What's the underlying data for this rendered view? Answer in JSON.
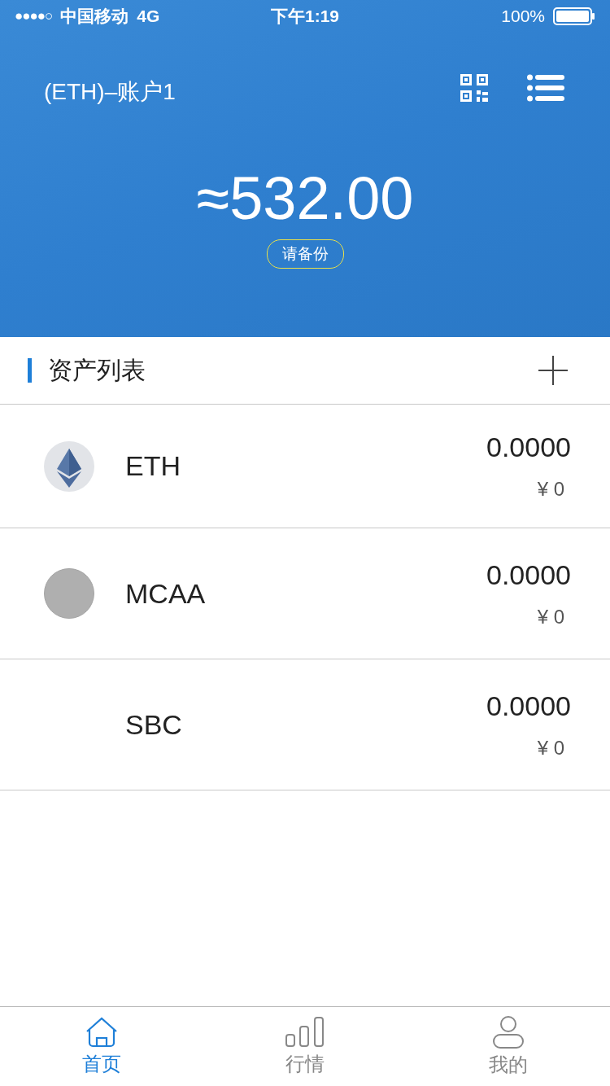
{
  "status_bar": {
    "signal": "●●●●○",
    "carrier": "中国移动",
    "network": "4G",
    "time": "下午1:19",
    "battery": "100%"
  },
  "header": {
    "account": "(ETH)–账户1",
    "balance": "≈532.00",
    "backup_badge": "请备份"
  },
  "section": {
    "title": "资产列表"
  },
  "assets": [
    {
      "kind": "eth",
      "name": "ETH",
      "amount": "0.0000",
      "value": "¥ 0"
    },
    {
      "kind": "plain",
      "name": "MCAA",
      "amount": "0.0000",
      "value": "¥ 0"
    },
    {
      "kind": "none",
      "name": "SBC",
      "amount": "0.0000",
      "value": "¥ 0"
    }
  ],
  "tabs": [
    {
      "kind": "home",
      "label": "首页",
      "selected": true
    },
    {
      "kind": "market",
      "label": "行情",
      "selected": false
    },
    {
      "kind": "profile",
      "label": "我的",
      "selected": false
    }
  ]
}
